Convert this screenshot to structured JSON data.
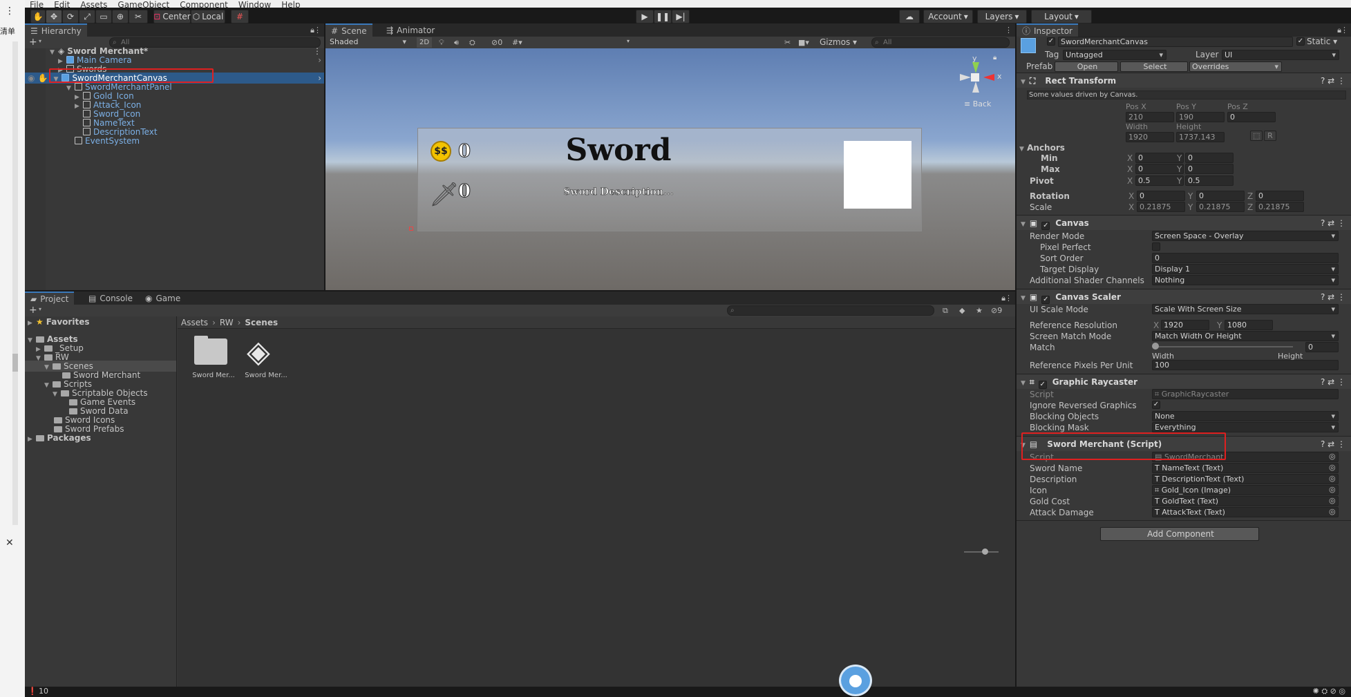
{
  "menu": [
    "File",
    "Edit",
    "Assets",
    "GameObject",
    "Component",
    "Window",
    "Help"
  ],
  "toolbar": {
    "pivot": "Center",
    "space": "Local",
    "account": "Account",
    "layers": "Layers",
    "layout": "Layout"
  },
  "leftstrip": {
    "dots": "⋮",
    "text": "清单",
    "close": "✕"
  },
  "hierarchy": {
    "tab": "Hierarchy",
    "add": "+",
    "search_placeholder": "All",
    "scene": "Sword Merchant*",
    "items": [
      "Main Camera",
      "Swords",
      "SwordMerchantCanvas",
      "SwordMerchantPanel",
      "Gold_Icon",
      "Attack_Icon",
      "Sword_Icon",
      "NameText",
      "DescriptionText",
      "EventSystem"
    ]
  },
  "scene": {
    "tabs": [
      "Scene",
      "Animator"
    ],
    "shading": "Shaded",
    "mode2d": "2D",
    "count": "0",
    "gizmos": "Gizmos",
    "search_placeholder": "All",
    "gizmo_back": "Back",
    "axis_y": "y",
    "axis_x": "x",
    "ui": {
      "gold": "$$",
      "zero1": "0",
      "zero2": "0",
      "title": "Sword",
      "desc": "Sword Description..."
    }
  },
  "inspector": {
    "tab": "Inspector",
    "object": "SwordMerchantCanvas",
    "static": "Static",
    "tag_label": "Tag",
    "tag": "Untagged",
    "layer_label": "Layer",
    "layer": "UI",
    "prefab_label": "Prefab",
    "open": "Open",
    "select": "Select",
    "overrides": "Overrides",
    "rect": {
      "title": "Rect Transform",
      "note": "Some values driven by Canvas.",
      "posx_l": "Pos X",
      "posy_l": "Pos Y",
      "posz_l": "Pos Z",
      "posx": "210",
      "posy": "190",
      "posz": "0",
      "width_l": "Width",
      "height_l": "Height",
      "width": "1920",
      "height": "1737.143",
      "r": "R",
      "anchors": "Anchors",
      "min": "Min",
      "max": "Max",
      "pivot": "Pivot",
      "rotation": "Rotation",
      "scale": "Scale",
      "min_x": "0",
      "min_y": "0",
      "max_x": "0",
      "max_y": "0",
      "pivot_x": "0.5",
      "pivot_y": "0.5",
      "rot_x": "0",
      "rot_y": "0",
      "rot_z": "0",
      "scale_x": "0.21875",
      "scale_y": "0.21875",
      "scale_z": "0.21875",
      "X": "X",
      "Y": "Y",
      "Z": "Z"
    },
    "canvas": {
      "title": "Canvas",
      "render_mode_l": "Render Mode",
      "render_mode": "Screen Space - Overlay",
      "pixel_perfect_l": "Pixel Perfect",
      "sort_order_l": "Sort Order",
      "sort_order": "0",
      "target_display_l": "Target Display",
      "target_display": "Display 1",
      "additional_l": "Additional Shader Channels",
      "additional": "Nothing"
    },
    "scaler": {
      "title": "Canvas Scaler",
      "mode_l": "UI Scale Mode",
      "mode": "Scale With Screen Size",
      "ref_res_l": "Reference Resolution",
      "ref_x": "1920",
      "ref_y": "1080",
      "match_mode_l": "Screen Match Mode",
      "match_mode": "Match Width Or Height",
      "match_l": "Match",
      "match": "0",
      "width": "Width",
      "height": "Height",
      "ppu_l": "Reference Pixels Per Unit",
      "ppu": "100"
    },
    "raycaster": {
      "title": "Graphic Raycaster",
      "script_l": "Script",
      "script": "GraphicRaycaster",
      "ignore_l": "Ignore Reversed Graphics",
      "blocking_l": "Blocking Objects",
      "blocking": "None",
      "mask_l": "Blocking Mask",
      "mask": "Everything"
    },
    "merchant": {
      "title": "Sword Merchant (Script)",
      "script_l": "Script",
      "script": "SwordMerchant",
      "fields": [
        {
          "label": "Sword Name",
          "value": "NameText (Text)"
        },
        {
          "label": "Description",
          "value": "DescriptionText (Text)"
        },
        {
          "label": "Icon",
          "value": "Gold_Icon (Image)"
        },
        {
          "label": "Gold Cost",
          "value": "GoldText (Text)"
        },
        {
          "label": "Attack Damage",
          "value": "AttackText (Text)"
        }
      ]
    },
    "add_component": "Add Component"
  },
  "project": {
    "tabs": [
      "Project",
      "Console",
      "Game"
    ],
    "add": "+",
    "hidden_count": "9",
    "tree": [
      "Favorites",
      "Assets",
      "_Setup",
      "RW",
      "Scenes",
      "Sword Merchant",
      "Scripts",
      "Scriptable Objects",
      "Game Events",
      "Sword Data",
      "Sword Icons",
      "Sword Prefabs",
      "Packages"
    ],
    "breadcrumb": [
      "Assets",
      "RW",
      "Scenes"
    ],
    "assets": [
      "Sword Mer...",
      "Sword Mer..."
    ]
  },
  "status": {
    "count": "10"
  }
}
